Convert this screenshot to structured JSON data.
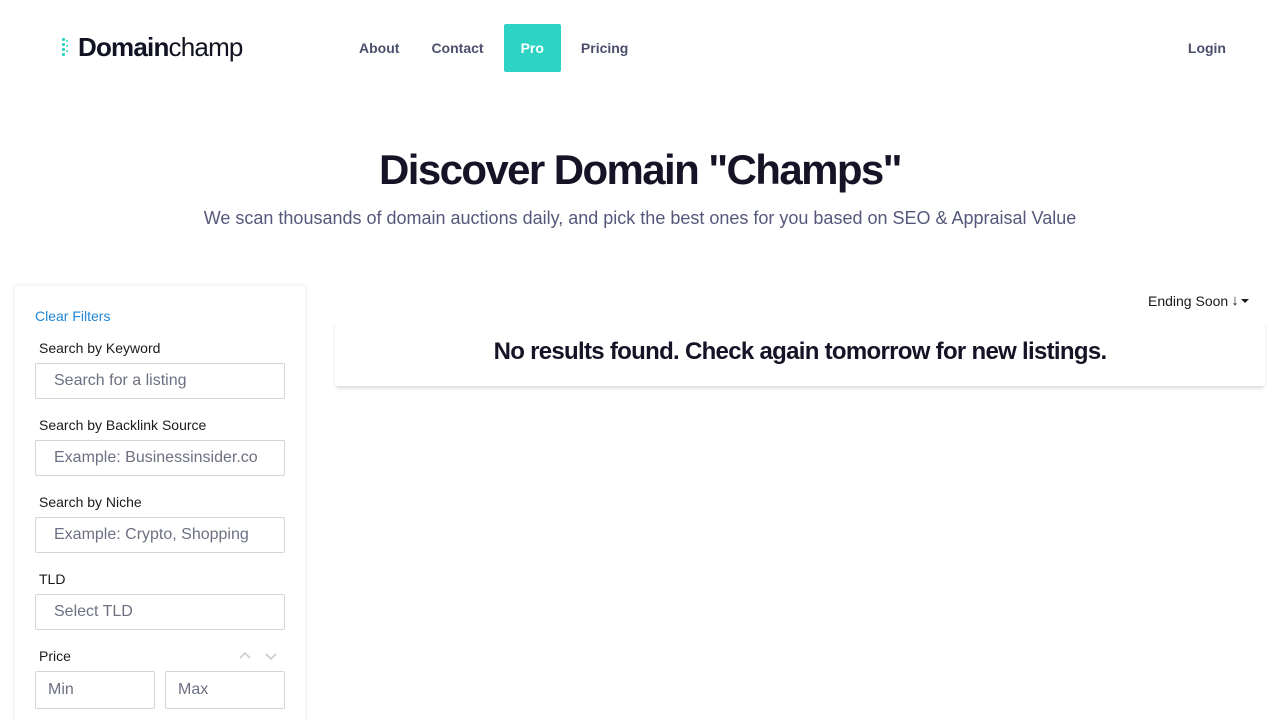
{
  "header": {
    "logo": {
      "bold": "Domain",
      "light": "champ"
    },
    "nav": [
      {
        "label": "About",
        "active": false
      },
      {
        "label": "Contact",
        "active": false
      },
      {
        "label": "Pro",
        "active": true
      },
      {
        "label": "Pricing",
        "active": false
      }
    ],
    "login_label": "Login"
  },
  "hero": {
    "title": "Discover Domain \"Champs\"",
    "subtitle": "We scan thousands of domain auctions daily, and pick the best ones for you based on SEO & Appraisal Value"
  },
  "filters": {
    "clear_label": "Clear Filters",
    "keyword": {
      "label": "Search by Keyword",
      "placeholder": "Search for a listing"
    },
    "backlink": {
      "label": "Search by Backlink Source",
      "placeholder": "Example: Businessinsider.co"
    },
    "niche": {
      "label": "Search by Niche",
      "placeholder": "Example: Crypto, Shopping"
    },
    "tld": {
      "label": "TLD",
      "placeholder": "Select TLD"
    },
    "price": {
      "label": "Price",
      "min_placeholder": "Min",
      "max_placeholder": "Max"
    }
  },
  "results": {
    "sort_label": "Ending Soon",
    "sort_arrow": "↓",
    "empty_message": "No results found. Check again tomorrow for new listings."
  },
  "colors": {
    "accent": "#2dd4c4",
    "link": "#1e86d6",
    "text_dark": "#141426",
    "text_muted": "#55587a"
  }
}
